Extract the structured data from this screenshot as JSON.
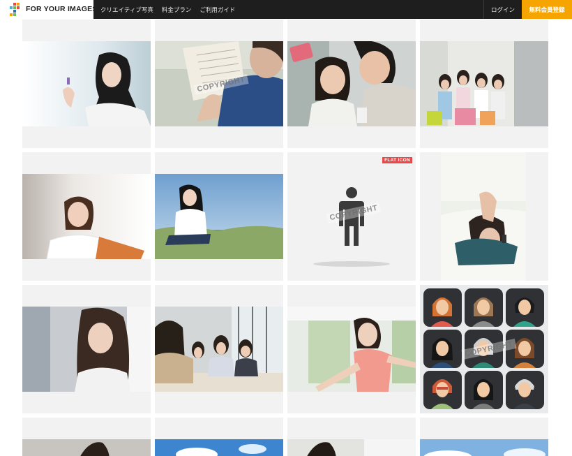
{
  "header": {
    "logo_text": "FOR YOUR IMAGES",
    "nav": [
      "クリエイティブ写真",
      "料金プラン",
      "ご利用ガイド"
    ],
    "login_label": "ログイン",
    "signup_label": "無料会員登録"
  },
  "watermark": "COPYRIGHT",
  "flat_icon_badge": "FLAT ICON",
  "colors": {
    "header_bg": "#1e1e1e",
    "signup_bg": "#f5a400",
    "tile_bg": "#f2f2f2",
    "badge_red": "#e84a4a"
  }
}
